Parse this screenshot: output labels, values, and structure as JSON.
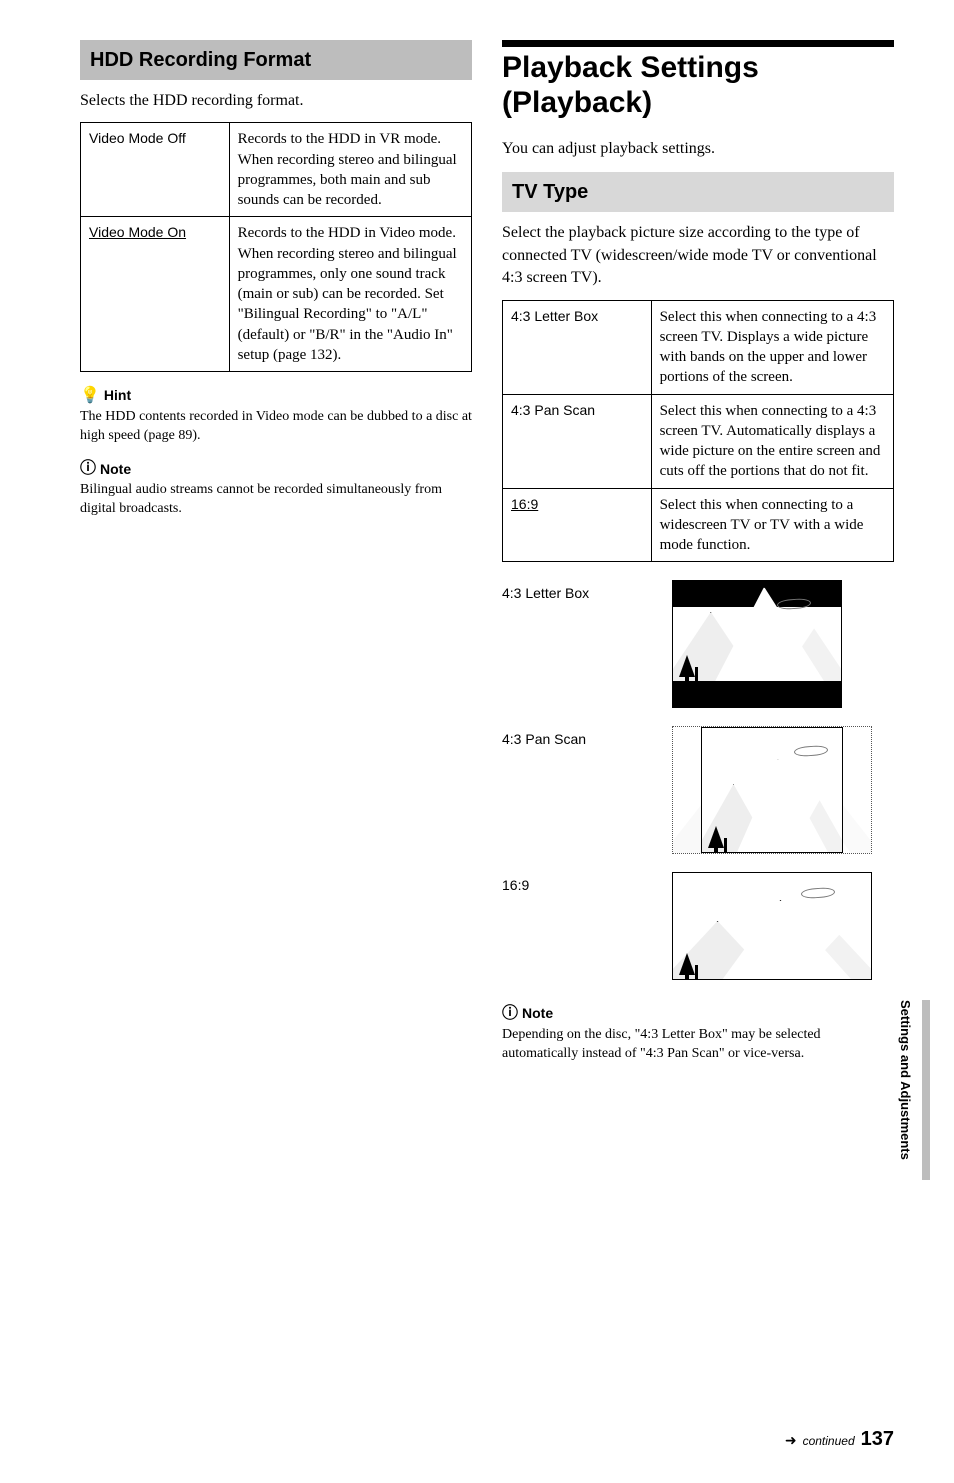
{
  "left": {
    "section_title": "HDD Recording Format",
    "intro": "Selects the HDD recording format.",
    "rows": [
      {
        "label": "Video Mode Off",
        "value": "Records to the HDD in VR mode.\nWhen recording stereo and bilingual programmes, both main and sub sounds can be recorded."
      },
      {
        "label": "Video Mode On",
        "value": "Records to the HDD in Video mode.\nWhen recording stereo and bilingual programmes, only one sound track (main or sub) can be recorded. Set \"Bilingual Recording\" to \"A/L\" (default) or \"B/R\" in the \"Audio In\" setup (page 132).",
        "underline": true
      }
    ],
    "hint_label": "Hint",
    "hint_text": "The HDD contents recorded in Video mode can be dubbed to a disc at high speed (page 89).",
    "note_label": "Note",
    "note_text": "Bilingual audio streams cannot be recorded simultaneously from digital broadcasts."
  },
  "right": {
    "big_title": "Playback Settings (Playback)",
    "intro": "You can adjust playback settings.",
    "section_title": "TV Type",
    "section_intro": "Select the playback picture size according to the type of connected TV (widescreen/wide mode TV or conventional 4:3 screen TV).",
    "rows": [
      {
        "label": "4:3 Letter Box",
        "value": "Select this when connecting to a 4:3 screen TV. Displays a wide picture with bands on the upper and lower portions of the screen."
      },
      {
        "label": "4:3 Pan Scan",
        "value": "Select this when connecting to a 4:3 screen TV. Automatically displays a wide picture on the entire screen and cuts off the portions that do not fit."
      },
      {
        "label": "16:9",
        "value": "Select this when connecting to a widescreen TV or TV with a wide mode function.",
        "underline": true
      }
    ],
    "ratio_labels": [
      "4:3 Letter Box",
      "4:3 Pan Scan",
      "16:9"
    ],
    "note_label": "Note",
    "note_text": "Depending on the disc, \"4:3 Letter Box\" may be selected automatically instead of \"4:3 Pan Scan\" or vice-versa."
  },
  "side_tab": "Settings and Adjustments",
  "footer": {
    "continued": "continued",
    "page": "137"
  }
}
